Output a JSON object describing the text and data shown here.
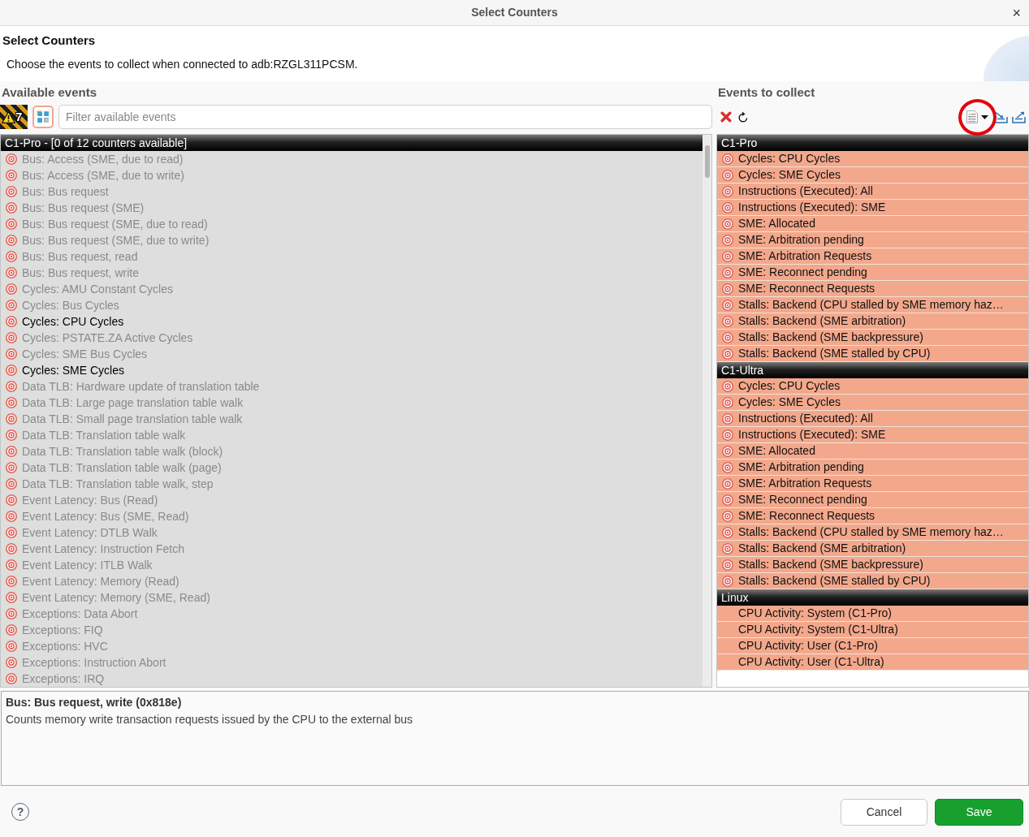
{
  "window": {
    "title": "Select Counters",
    "close": "×"
  },
  "header": {
    "title": "Select Counters",
    "description": "Choose the events to collect when connected to adb:RZGL311PCSM."
  },
  "available": {
    "label": "Available events",
    "warning_count": "7",
    "filter": {
      "placeholder": "Filter available events"
    },
    "groups": [
      {
        "name": "C1-Pro - [0 of 12 counters available]",
        "items": [
          {
            "label": "Bus: Access (SME, due to read)",
            "disabled": true
          },
          {
            "label": "Bus: Access (SME, due to write)",
            "disabled": true
          },
          {
            "label": "Bus: Bus request",
            "disabled": true
          },
          {
            "label": "Bus: Bus request (SME)",
            "disabled": true
          },
          {
            "label": "Bus: Bus request (SME, due to read)",
            "disabled": true
          },
          {
            "label": "Bus: Bus request (SME, due to write)",
            "disabled": true
          },
          {
            "label": "Bus: Bus request, read",
            "disabled": true
          },
          {
            "label": "Bus: Bus request, write",
            "disabled": true
          },
          {
            "label": "Cycles: AMU Constant Cycles",
            "disabled": true
          },
          {
            "label": "Cycles: Bus Cycles",
            "disabled": true
          },
          {
            "label": "Cycles: CPU Cycles",
            "disabled": false
          },
          {
            "label": "Cycles: PSTATE.ZA Active Cycles",
            "disabled": true
          },
          {
            "label": "Cycles: SME Bus Cycles",
            "disabled": true
          },
          {
            "label": "Cycles: SME Cycles",
            "disabled": false
          },
          {
            "label": "Data TLB: Hardware update of translation table",
            "disabled": true
          },
          {
            "label": "Data TLB: Large page translation table walk",
            "disabled": true
          },
          {
            "label": "Data TLB: Small page translation table walk",
            "disabled": true
          },
          {
            "label": "Data TLB: Translation table walk",
            "disabled": true
          },
          {
            "label": "Data TLB: Translation table walk (block)",
            "disabled": true
          },
          {
            "label": "Data TLB: Translation table walk (page)",
            "disabled": true
          },
          {
            "label": "Data TLB: Translation table walk, step",
            "disabled": true
          },
          {
            "label": "Event Latency: Bus (Read)",
            "disabled": true
          },
          {
            "label": "Event Latency: Bus (SME, Read)",
            "disabled": true
          },
          {
            "label": "Event Latency: DTLB Walk",
            "disabled": true
          },
          {
            "label": "Event Latency: Instruction Fetch",
            "disabled": true
          },
          {
            "label": "Event Latency: ITLB Walk",
            "disabled": true
          },
          {
            "label": "Event Latency: Memory (Read)",
            "disabled": true
          },
          {
            "label": "Event Latency: Memory (SME, Read)",
            "disabled": true
          },
          {
            "label": "Exceptions: Data Abort",
            "disabled": true
          },
          {
            "label": "Exceptions: FIQ",
            "disabled": true
          },
          {
            "label": "Exceptions: HVC",
            "disabled": true
          },
          {
            "label": "Exceptions: Instruction Abort",
            "disabled": true
          },
          {
            "label": "Exceptions: IRQ",
            "disabled": true
          }
        ]
      }
    ]
  },
  "collect": {
    "label": "Events to collect",
    "tools": [
      {
        "kind": "delete",
        "circled": false
      },
      {
        "kind": "refresh",
        "circled": false
      },
      {
        "kind": "menu",
        "circled": true
      },
      {
        "kind": "import",
        "circled": false
      },
      {
        "kind": "export",
        "circled": false
      }
    ],
    "groups": [
      {
        "name": "C1-Pro",
        "items": [
          {
            "label": "Cycles: CPU Cycles",
            "kind": "counter"
          },
          {
            "label": "Cycles: SME Cycles",
            "kind": "counter"
          },
          {
            "label": "Instructions (Executed): All",
            "kind": "counter"
          },
          {
            "label": "Instructions (Executed): SME",
            "kind": "counter"
          },
          {
            "label": "SME: Allocated",
            "kind": "counter"
          },
          {
            "label": "SME: Arbitration pending",
            "kind": "counter"
          },
          {
            "label": "SME: Arbitration Requests",
            "kind": "counter"
          },
          {
            "label": "SME: Reconnect pending",
            "kind": "counter"
          },
          {
            "label": "SME: Reconnect Requests",
            "kind": "counter"
          },
          {
            "label": "Stalls: Backend (CPU stalled by SME memory haz…",
            "kind": "counter"
          },
          {
            "label": "Stalls: Backend (SME arbitration)",
            "kind": "counter"
          },
          {
            "label": "Stalls: Backend (SME backpressure)",
            "kind": "counter"
          },
          {
            "label": "Stalls: Backend (SME stalled by CPU)",
            "kind": "counter"
          }
        ]
      },
      {
        "name": "C1-Ultra",
        "items": [
          {
            "label": "Cycles: CPU Cycles",
            "kind": "counter"
          },
          {
            "label": "Cycles: SME Cycles",
            "kind": "counter"
          },
          {
            "label": "Instructions (Executed): All",
            "kind": "counter"
          },
          {
            "label": "Instructions (Executed): SME",
            "kind": "counter"
          },
          {
            "label": "SME: Allocated",
            "kind": "counter"
          },
          {
            "label": "SME: Arbitration pending",
            "kind": "counter"
          },
          {
            "label": "SME: Arbitration Requests",
            "kind": "counter"
          },
          {
            "label": "SME: Reconnect pending",
            "kind": "counter"
          },
          {
            "label": "SME: Reconnect Requests",
            "kind": "counter"
          },
          {
            "label": "Stalls: Backend (CPU stalled by SME memory haz…",
            "kind": "counter"
          },
          {
            "label": "Stalls: Backend (SME arbitration)",
            "kind": "counter"
          },
          {
            "label": "Stalls: Backend (SME backpressure)",
            "kind": "counter"
          },
          {
            "label": "Stalls: Backend (SME stalled by CPU)",
            "kind": "counter"
          }
        ]
      },
      {
        "name": "Linux",
        "items": [
          {
            "label": "CPU Activity: System (C1-Pro)",
            "kind": "plain"
          },
          {
            "label": "CPU Activity: System (C1-Ultra)",
            "kind": "plain"
          },
          {
            "label": "CPU Activity: User (C1-Pro)",
            "kind": "plain"
          },
          {
            "label": "CPU Activity: User (C1-Ultra)",
            "kind": "plain"
          }
        ]
      }
    ]
  },
  "details": {
    "title": "Bus: Bus request, write (0x818e)",
    "text": "Counts memory write transaction requests issued by the CPU to the external bus"
  },
  "footer": {
    "help": "?",
    "buttons": [
      {
        "label": "Cancel",
        "kind": "secondary"
      },
      {
        "label": "Save",
        "kind": "primary"
      }
    ]
  }
}
